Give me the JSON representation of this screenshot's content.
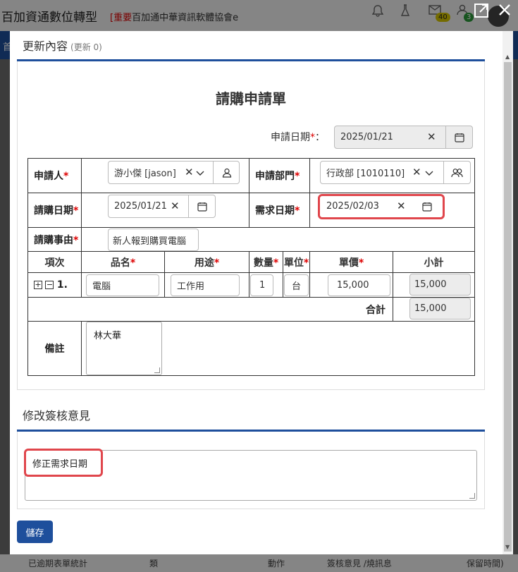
{
  "background": {
    "app_title": "百加資通數位轉型",
    "news_tag": "[重要",
    "news_text": "百加通中華資訊軟體協會e",
    "badge_mail": "40",
    "badge_user": "3",
    "nav_char": "首",
    "bottom_left": "已逾期表單統計",
    "bottom_col1": "類",
    "bottom_col2": "動作",
    "bottom_col3": "簽核意見 /燒訊息",
    "bottom_col4": "保留時間)"
  },
  "modal": {
    "section1_title": "更新內容",
    "section1_count": "(更新 0)",
    "form_title": "請購申請單",
    "apply_date_label": "申請日期",
    "apply_date_colon": "：",
    "apply_date_value": "2025/01/21",
    "applicant_label": "申請人",
    "applicant_value": "游小傑 [jason]",
    "dept_label": "申請部門",
    "dept_value": "行政部 [1010110]",
    "purchase_date_label": "請購日期",
    "purchase_date_value": "2025/01/21",
    "need_date_label": "需求日期",
    "need_date_value": "2025/02/03",
    "reason_label": "請購事由",
    "reason_value": "新人報到購買電腦",
    "columns": {
      "item": "項次",
      "name": "品名",
      "usage": "用途",
      "qty": "數量",
      "unit": "單位",
      "price": "單價",
      "subtotal": "小計"
    },
    "row": {
      "index": "1.",
      "name": "電腦",
      "usage": "工作用",
      "qty": "1",
      "unit": "台",
      "price": "15,000",
      "subtotal": "15,000"
    },
    "total_label": "合計",
    "total_value": "15,000",
    "remark_label": "備註",
    "remark_value": "林大華",
    "section2_title": "修改簽核意見",
    "opinion_value": "修正需求日期",
    "save_label": "儲存",
    "required_mark": "*"
  }
}
